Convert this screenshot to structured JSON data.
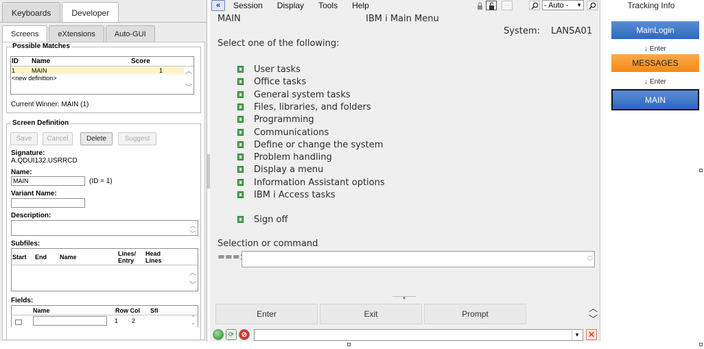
{
  "left_panel": {
    "main_tabs": [
      "Keyboards",
      "Developer"
    ],
    "sub_tabs": [
      "Screens",
      "eXtensions",
      "Auto-GUI"
    ],
    "possible_matches": {
      "legend": "Possible Matches",
      "headers": {
        "id": "ID",
        "name": "Name",
        "score": "Score"
      },
      "rows": [
        {
          "id": "1",
          "name": "MAIN",
          "score": "1"
        }
      ],
      "new_def": "<new definition>",
      "current_winner": "Current Winner: MAIN (1)"
    },
    "screen_definition": {
      "legend": "Screen Definition",
      "buttons": {
        "save": "Save",
        "cancel": "Cancel",
        "delete": "Delete",
        "suggest": "Suggest"
      },
      "signature_label": "Signature:",
      "signature_value": "A.QDUI132.USRRCD",
      "name_label": "Name:",
      "name_value": "MAIN",
      "name_id": "(ID = 1)",
      "variant_label": "Variant Name:",
      "variant_value": "",
      "description_label": "Description:",
      "description_value": "",
      "subfiles_label": "Subfiles:",
      "subfile_headers": {
        "start": "Start",
        "end": "End",
        "name": "Name",
        "lines_1": "Lines/",
        "lines_2": "Entry",
        "head_1": "Head",
        "head_2": "Lines"
      },
      "fields_label": "Fields:",
      "field_headers": {
        "name": "Name",
        "rowcol": "Row Col",
        "sfl": "Sfl"
      },
      "field_row": {
        "name": "",
        "row": "1",
        "col": "2"
      }
    }
  },
  "terminal": {
    "menu": [
      "Session",
      "Display",
      "Tools",
      "Help"
    ],
    "back_icon": "«",
    "mode_select": "- Auto -",
    "screen_name": "MAIN",
    "screen_title": "IBM i Main Menu",
    "system_label": "System:",
    "system_value": "LANSA01",
    "prompt": "Select one of the following:",
    "options": [
      "User tasks",
      "Office tasks",
      "General system tasks",
      "Files, libraries, and folders",
      "Programming",
      "Communications",
      "Define or change the system",
      "Problem handling",
      "Display a menu",
      "Information Assistant options",
      "IBM i Access tasks"
    ],
    "signoff": "Sign off",
    "selection_label": "Selection or command",
    "cmd_arrow": "===>",
    "cmd_value": "",
    "fkeys": [
      "Enter",
      "Exit",
      "Prompt"
    ],
    "status_input_value": ""
  },
  "tracking": {
    "title": "Tracking Info",
    "steps": [
      {
        "label": "MainLogin",
        "style": "blue"
      },
      {
        "label": "MESSAGES",
        "style": "orange"
      },
      {
        "label": "MAIN",
        "style": "current"
      }
    ],
    "enter_labels": [
      "↓ Enter",
      "↓ Enter"
    ]
  },
  "colors": {
    "accent_blue": "#2d68c0",
    "accent_orange": "#f28a16",
    "option_icon": "#4ea84e",
    "selected_row": "#fff4c8"
  }
}
